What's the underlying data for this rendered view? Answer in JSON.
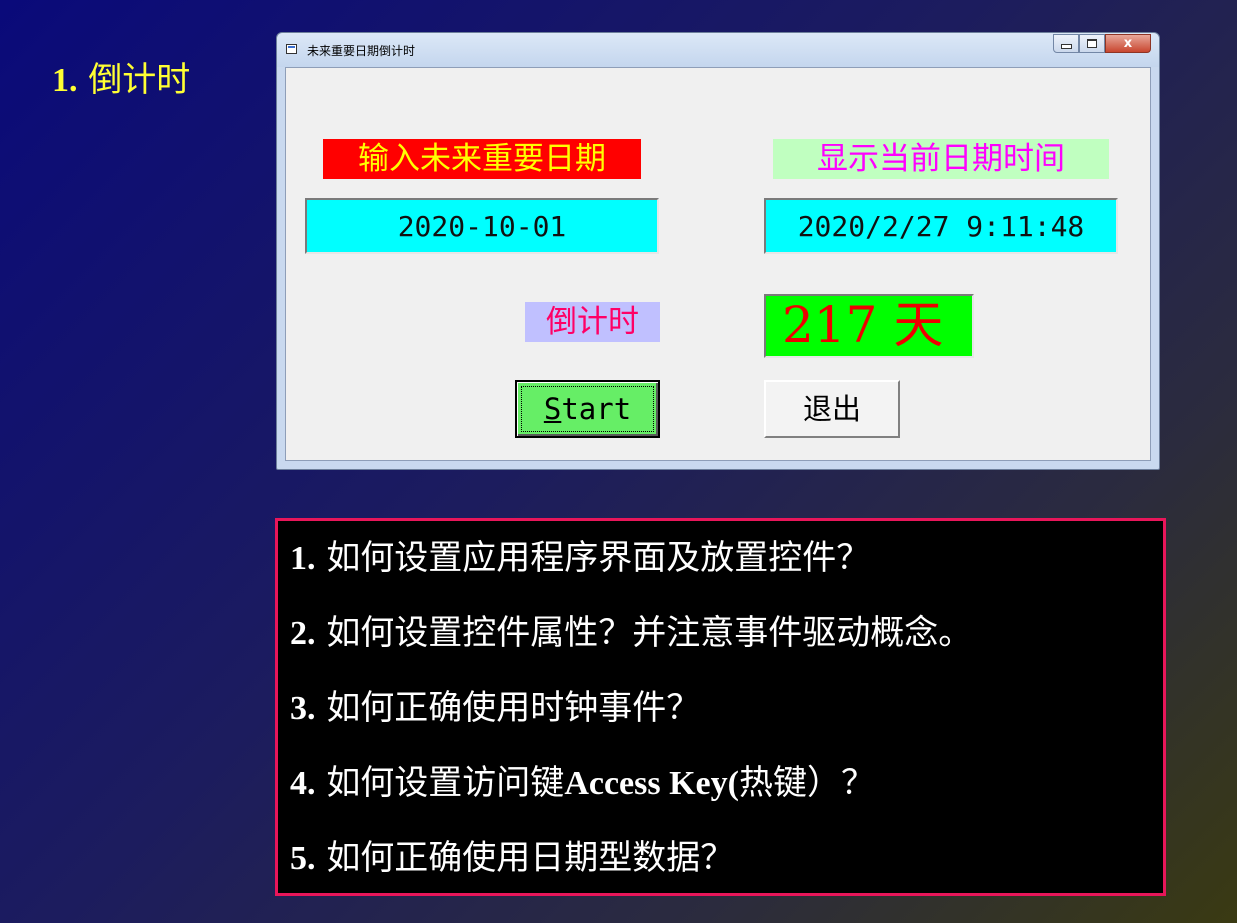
{
  "slide": {
    "heading_number": "1.",
    "heading_text": "倒计时"
  },
  "window": {
    "title": "未来重要日期倒计时",
    "close_glyph": "x",
    "labels": {
      "input_date": "输入未来重要日期",
      "current_datetime": "显示当前日期时间",
      "countdown": "倒计时"
    },
    "fields": {
      "future_date": "2020-10-01",
      "current_datetime": "2020/2/27 9:11:48"
    },
    "days_remaining": "217 天",
    "buttons": {
      "start_accel": "S",
      "start_rest": "tart",
      "exit": "退出"
    }
  },
  "questions": [
    {
      "num": "1.",
      "text": "如何设置应用程序界面及放置控件？"
    },
    {
      "num": "2.",
      "text": "如何设置控件属性？并注意事件驱动概念。"
    },
    {
      "num": "3.",
      "text": "如何正确使用时钟事件？"
    },
    {
      "num": "4.",
      "text_before": "如何设置访问键",
      "text_bold": "Access Key(",
      "text_after": "热键）？"
    },
    {
      "num": "5.",
      "text": "如何正确使用日期型数据？"
    }
  ],
  "colors": {
    "heading": "#ffff33",
    "input_label_bg": "#ff0000",
    "input_label_fg": "#ffff00",
    "current_label_bg": "#c0ffc0",
    "current_label_fg": "#ff00ff",
    "countdown_label_bg": "#c0c0ff",
    "countdown_label_fg": "#ff0066",
    "field_bg": "#00ffff",
    "days_bg": "#00ff00",
    "days_fg": "#ee0000",
    "start_bg": "#66ee66",
    "question_border": "#e8165a"
  }
}
